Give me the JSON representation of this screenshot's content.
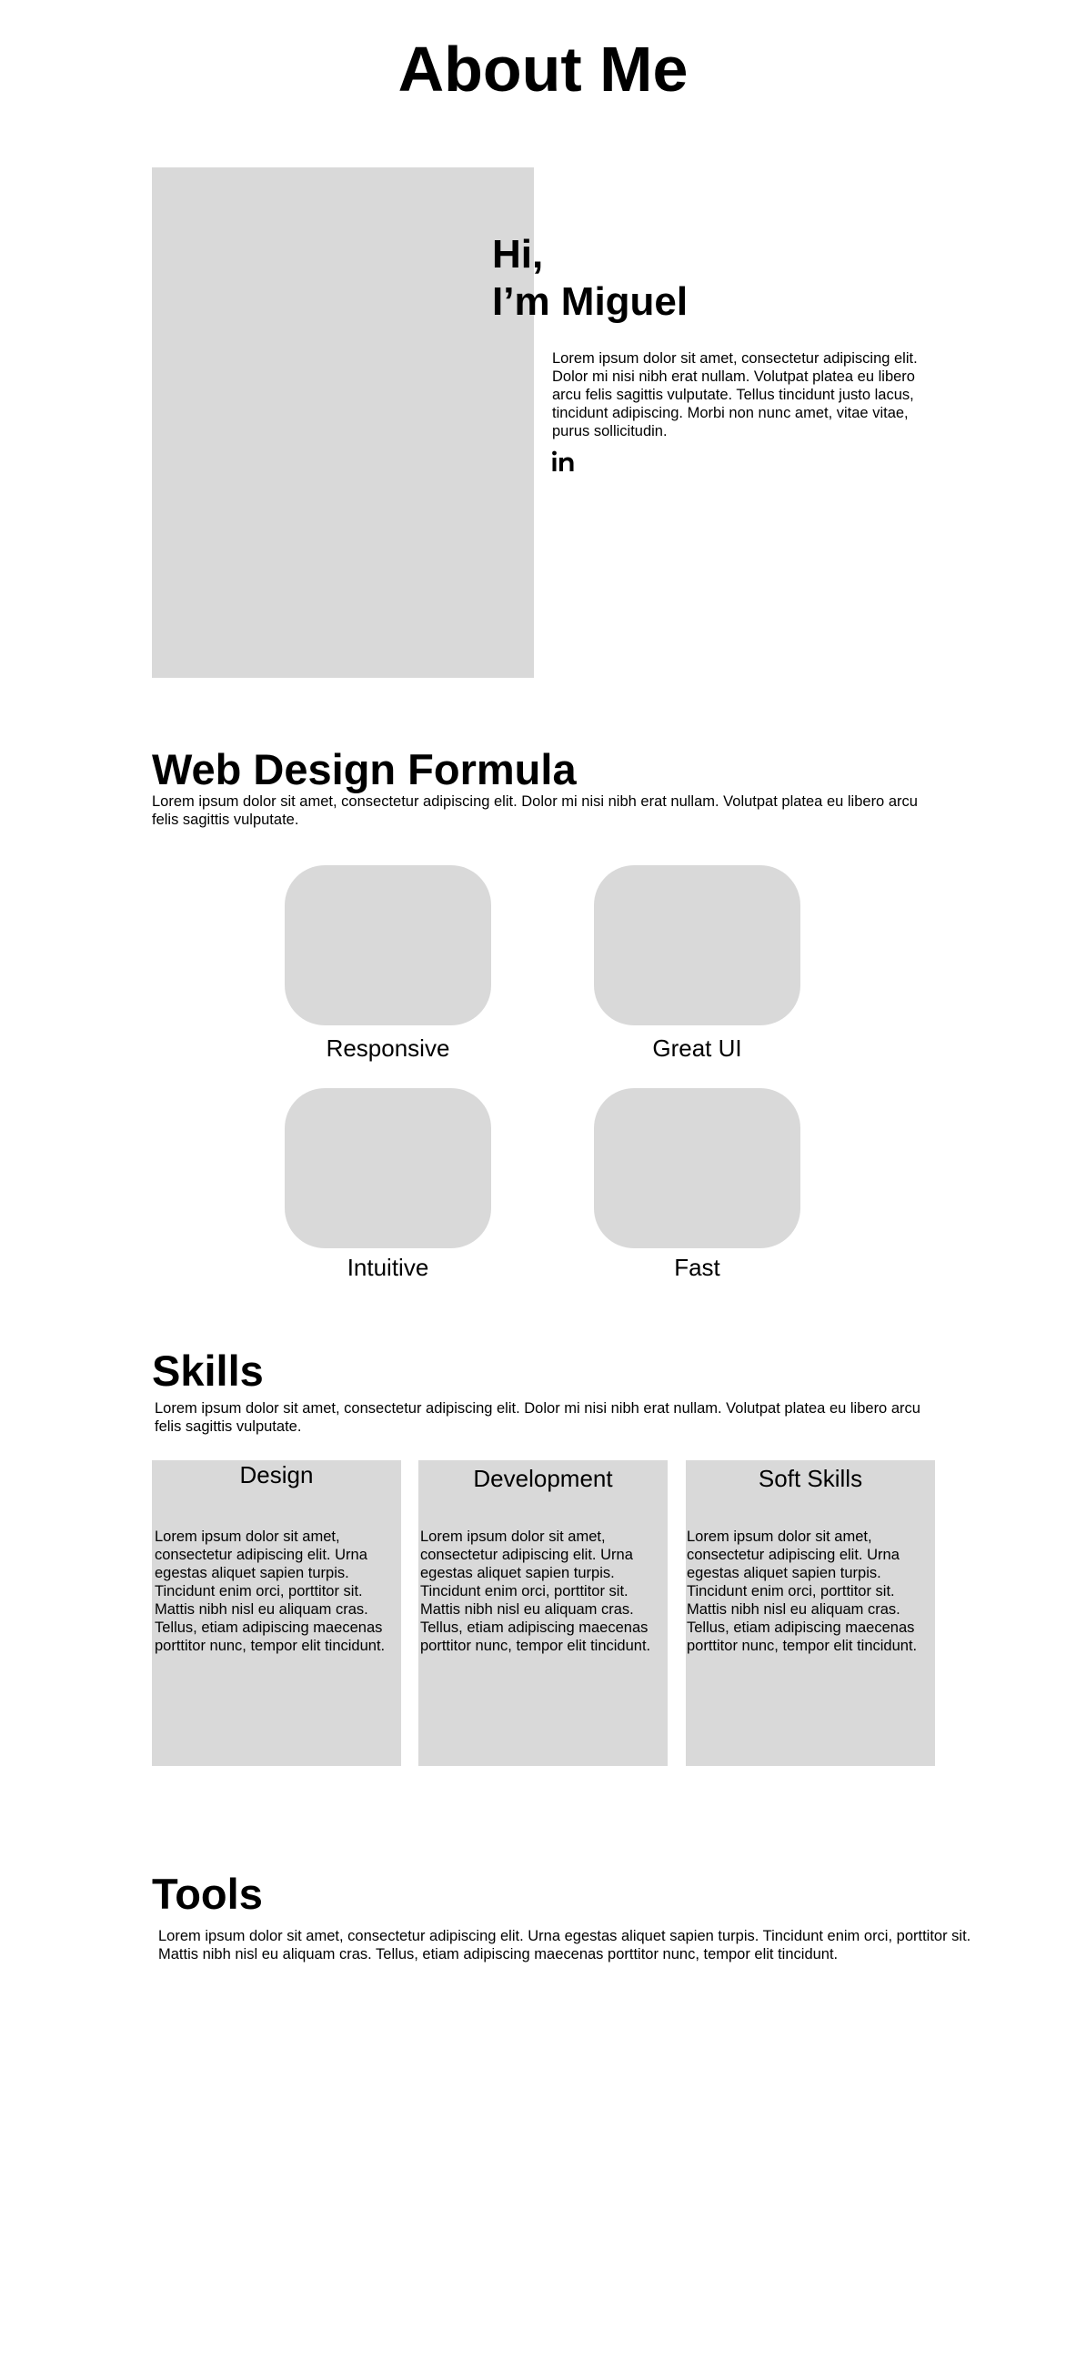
{
  "header": {
    "title": "About Me"
  },
  "hero": {
    "greeting_line1": "Hi,",
    "greeting_line2": "I’m Miguel",
    "intro": "Lorem ipsum dolor sit amet, consectetur adipiscing elit. Dolor mi nisi nibh erat nullam. Volutpat platea eu libero arcu felis sagittis vulputate. Tellus tincidunt justo lacus, tincidunt adipiscing. Morbi non nunc amet, vitae vitae, purus sollicitudin.",
    "linkedin_icon": "linkedin-icon"
  },
  "formula": {
    "title": "Web Design Formula",
    "description": "Lorem ipsum dolor sit amet, consectetur adipiscing elit. Dolor mi nisi nibh erat nullam. Volutpat platea eu libero arcu felis sagittis vulputate.",
    "features": [
      {
        "label": "Responsive"
      },
      {
        "label": "Great UI"
      },
      {
        "label": "Intuitive"
      },
      {
        "label": "Fast"
      }
    ]
  },
  "skills": {
    "title": "Skills",
    "description": "Lorem ipsum dolor sit amet, consectetur adipiscing elit. Dolor mi nisi nibh erat nullam. Volutpat platea eu libero arcu felis sagittis vulputate.",
    "cards": [
      {
        "title": "Design",
        "text": "Lorem ipsum dolor sit amet, consectetur adipiscing elit. Urna egestas aliquet sapien turpis. Tincidunt enim orci, porttitor sit. Mattis nibh nisl eu aliquam cras. Tellus, etiam adipiscing maecenas porttitor nunc, tempor elit tincidunt."
      },
      {
        "title": "Development",
        "text": "Lorem ipsum dolor sit amet, consectetur adipiscing elit. Urna egestas aliquet sapien turpis. Tincidunt enim orci, porttitor sit. Mattis nibh nisl eu aliquam cras. Tellus, etiam adipiscing maecenas porttitor nunc, tempor elit tincidunt."
      },
      {
        "title": "Soft Skills",
        "text": "Lorem ipsum dolor sit amet, consectetur adipiscing elit. Urna egestas aliquet sapien turpis. Tincidunt enim orci, porttitor sit. Mattis nibh nisl eu aliquam cras. Tellus, etiam adipiscing maecenas porttitor nunc, tempor elit tincidunt."
      }
    ]
  },
  "tools": {
    "title": "Tools",
    "description": "Lorem ipsum dolor sit amet, consectetur adipiscing elit. Urna egestas aliquet sapien turpis. Tincidunt enim orci, porttitor sit. Mattis nibh nisl eu aliquam cras. Tellus, etiam adipiscing maecenas porttitor nunc, tempor elit tincidunt."
  },
  "colors": {
    "placeholder": "#d9d9d9",
    "text": "#000000",
    "background": "#ffffff"
  }
}
